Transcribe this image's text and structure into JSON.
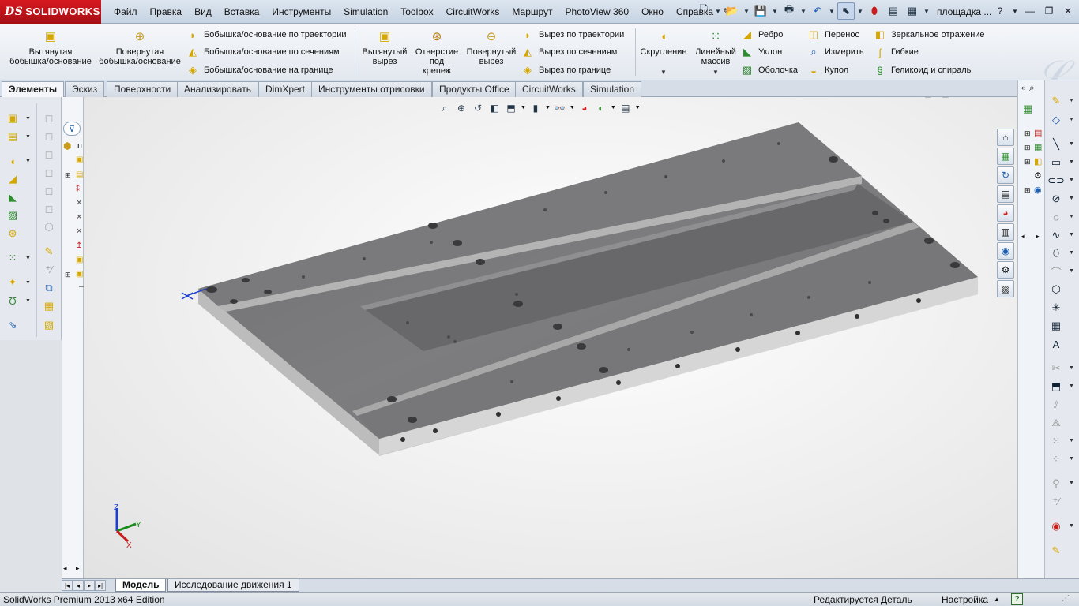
{
  "app": {
    "logo_text": "SOLIDWORKS",
    "logo_mark": "DS",
    "document_title": "площадка ..."
  },
  "menu": [
    "Файл",
    "Правка",
    "Вид",
    "Вставка",
    "Инструменты",
    "Simulation",
    "Toolbox",
    "CircuitWorks",
    "Маршрут",
    "PhotoView 360",
    "Окно",
    "Справка"
  ],
  "command_manager": {
    "extrude_boss": "Вытянутая\nбобышка/основание",
    "revolve_boss": "Повернутая\nбобышка/основание",
    "sweep_boss": "Бобышка/основание по траектории",
    "loft_boss": "Бобышка/основание по сечениям",
    "boundary_boss": "Бобышка/основание на границе",
    "extrude_cut": "Вытянутый\nвырез",
    "hole_wizard": "Отверстие\nпод\nкрепеж",
    "revolve_cut": "Повернутый\nвырез",
    "sweep_cut": "Вырез по траектории",
    "loft_cut": "Вырез по сечениям",
    "boundary_cut": "Вырез по границе",
    "fillet": "Скругление",
    "linear_pattern": "Линейный\nмассив",
    "rib": "Ребро",
    "draft": "Уклон",
    "shell": "Оболочка",
    "move_copy": "Перенос",
    "measure": "Измерить",
    "dome": "Купол",
    "mirror": "Зеркальное отражение",
    "flex": "Гибкие",
    "helix": "Геликоид и спираль"
  },
  "tabs": [
    "Элементы",
    "Эскиз",
    "Поверхности",
    "Анализировать",
    "DimXpert",
    "Инструменты отрисовки",
    "Продукты Office",
    "CircuitWorks",
    "Simulation"
  ],
  "feature_tree": {
    "root_label": "п"
  },
  "triad": {
    "z": "Z",
    "y": "Y",
    "x": "X"
  },
  "bottom_tabs": [
    "Модель",
    "Исследование движения 1"
  ],
  "status": {
    "edition": "SolidWorks Premium 2013 x64 Edition",
    "mode": "Редактируется Деталь",
    "customize": "Настройка",
    "help": "?"
  },
  "colors": {
    "brand": "#d71920",
    "part_top": "#7a7a7c",
    "part_side": "#d8d8d8"
  }
}
